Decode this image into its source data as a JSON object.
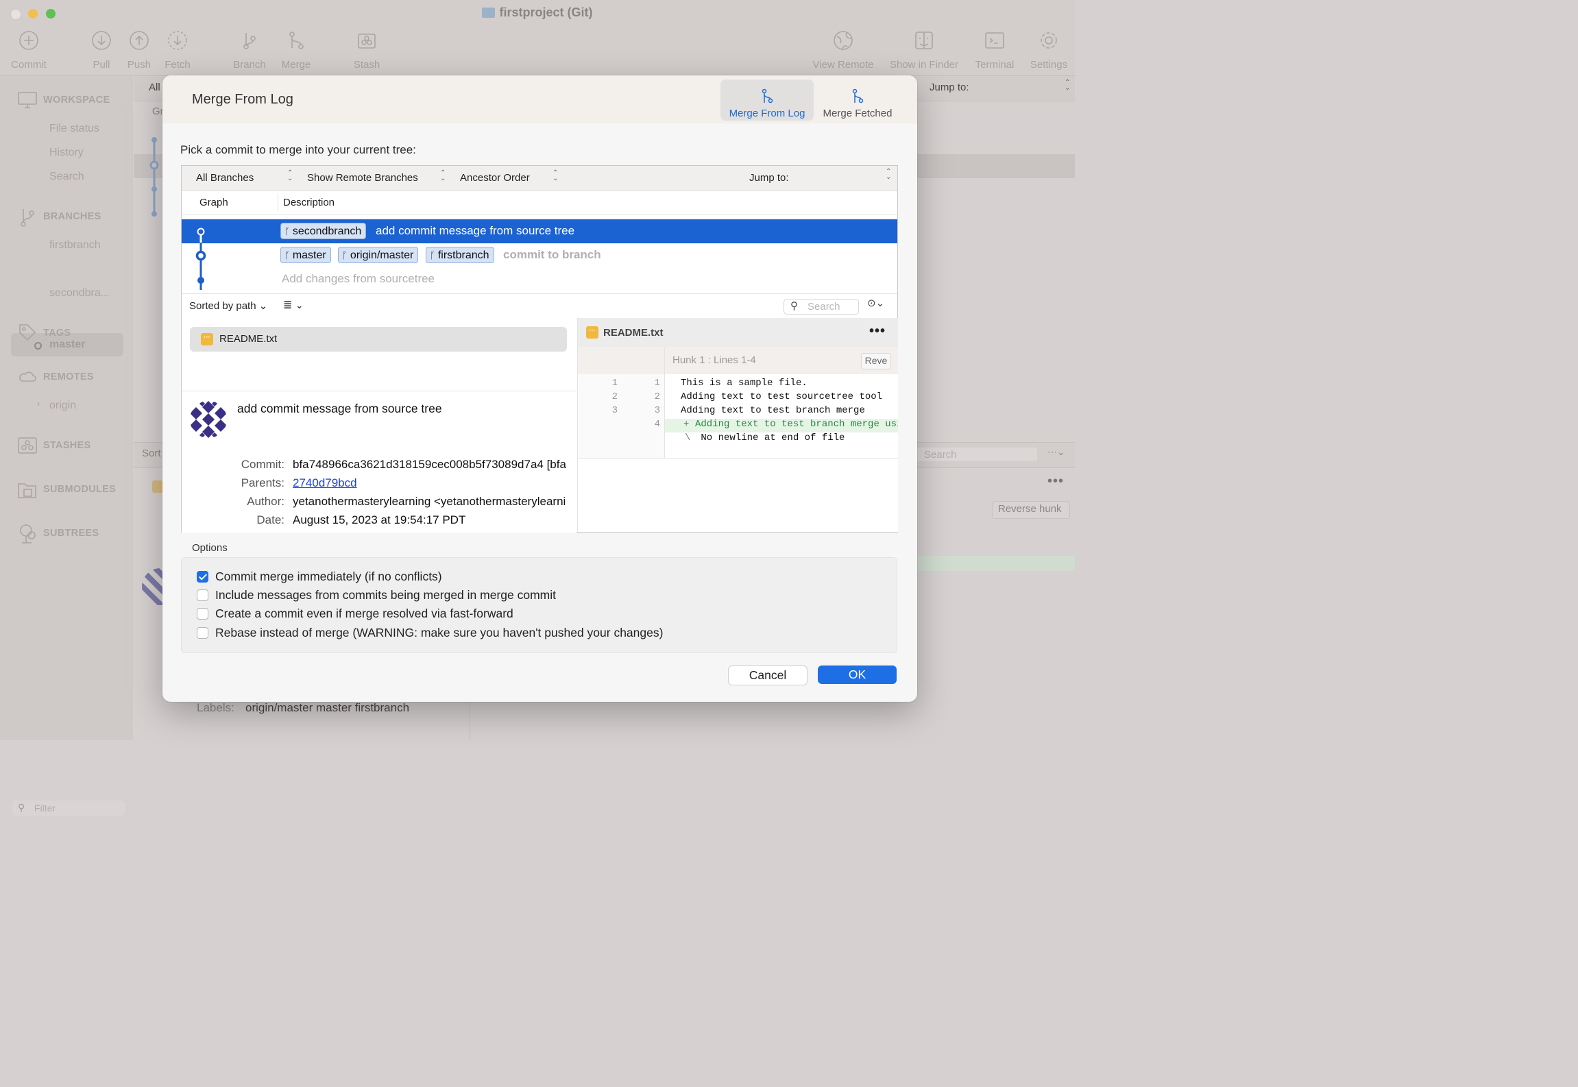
{
  "window": {
    "title": "firstproject (Git)"
  },
  "toolbar": {
    "commit": "Commit",
    "pull": "Pull",
    "push": "Push",
    "fetch": "Fetch",
    "branch": "Branch",
    "merge": "Merge",
    "stash": "Stash",
    "view_remote": "View Remote",
    "show_in_finder": "Show in Finder",
    "terminal": "Terminal",
    "settings": "Settings"
  },
  "sidebar": {
    "workspace": "WORKSPACE",
    "file_status": "File status",
    "history": "History",
    "search": "Search",
    "branches": "BRANCHES",
    "branch_items": [
      "firstbranch",
      "master",
      "secondbra..."
    ],
    "tags": "TAGS",
    "remotes": "REMOTES",
    "remote_items": [
      "origin"
    ],
    "stashes": "STASHES",
    "submodules": "SUBMODULES",
    "subtrees": "SUBTREES",
    "filter_placeholder": "Filter"
  },
  "background": {
    "all": "All",
    "gr": "Gr",
    "jump_to": "Jump to:",
    "sort": "Sort",
    "search": "Search",
    "reverse_hunk": "Reverse hunk",
    "labels_label": "Labels:",
    "labels_value": "origin/master master firstbranch"
  },
  "dialog": {
    "title": "Merge From Log",
    "tabs": [
      "Merge From Log",
      "Merge Fetched"
    ],
    "prompt": "Pick a commit to merge into your current tree:",
    "filters": {
      "branches": "All Branches",
      "remote": "Show Remote Branches",
      "order": "Ancestor Order",
      "jump_to": "Jump to:"
    },
    "columns": {
      "graph": "Graph",
      "description": "Description"
    },
    "commits": [
      {
        "tags": [
          "secondbranch"
        ],
        "message": "add commit message from source tree",
        "selected": true
      },
      {
        "tags": [
          "master",
          "origin/master",
          "firstbranch"
        ],
        "message": "commit to branch",
        "selected": false
      },
      {
        "tags": [],
        "message": "Add changes from sourcetree",
        "selected": false
      }
    ],
    "file_toolbar": {
      "sort": "Sorted by path",
      "search_placeholder": "Search"
    },
    "files": [
      "README.txt"
    ],
    "commit_details": {
      "message": "add commit message from source tree",
      "commit_label": "Commit:",
      "commit": "bfa748966ca3621d318159cec008b5f73089d7a4 [bfa",
      "parents_label": "Parents:",
      "parents": "2740d79bcd",
      "author_label": "Author:",
      "author": "yetanothermasterylearning <yetanothermasterylearni",
      "date_label": "Date:",
      "date": "August 15, 2023 at 19:54:17 PDT"
    },
    "diff": {
      "file": "README.txt",
      "hunk": "Hunk 1 : Lines 1-4",
      "reverse": "Reve",
      "lines": [
        {
          "old": "1",
          "new": "1",
          "mark": "",
          "text": "This is a sample file."
        },
        {
          "old": "2",
          "new": "2",
          "mark": "",
          "text": "Adding text to test sourcetree tool"
        },
        {
          "old": "3",
          "new": "3",
          "mark": "",
          "text": "Adding text to test branch merge"
        },
        {
          "old": "",
          "new": "4",
          "mark": "+",
          "text": "Adding text to test branch merge usi"
        },
        {
          "old": "",
          "new": "",
          "mark": "\\",
          "text": " No newline at end of file"
        }
      ]
    },
    "options_title": "Options",
    "options": [
      {
        "label": "Commit merge immediately (if no conflicts)",
        "checked": true
      },
      {
        "label": "Include messages from commits being merged in merge commit",
        "checked": false
      },
      {
        "label": "Create a commit even if merge resolved via fast-forward",
        "checked": false
      },
      {
        "label": "Rebase instead of merge (WARNING: make sure you haven't pushed your changes)",
        "checked": false
      }
    ],
    "cancel": "Cancel",
    "ok": "OK"
  },
  "colors": {
    "accent": "#1e6ee6",
    "selection": "#1b62d2",
    "graph": "#1b5fc9",
    "file_icon": "#f0b83f"
  }
}
